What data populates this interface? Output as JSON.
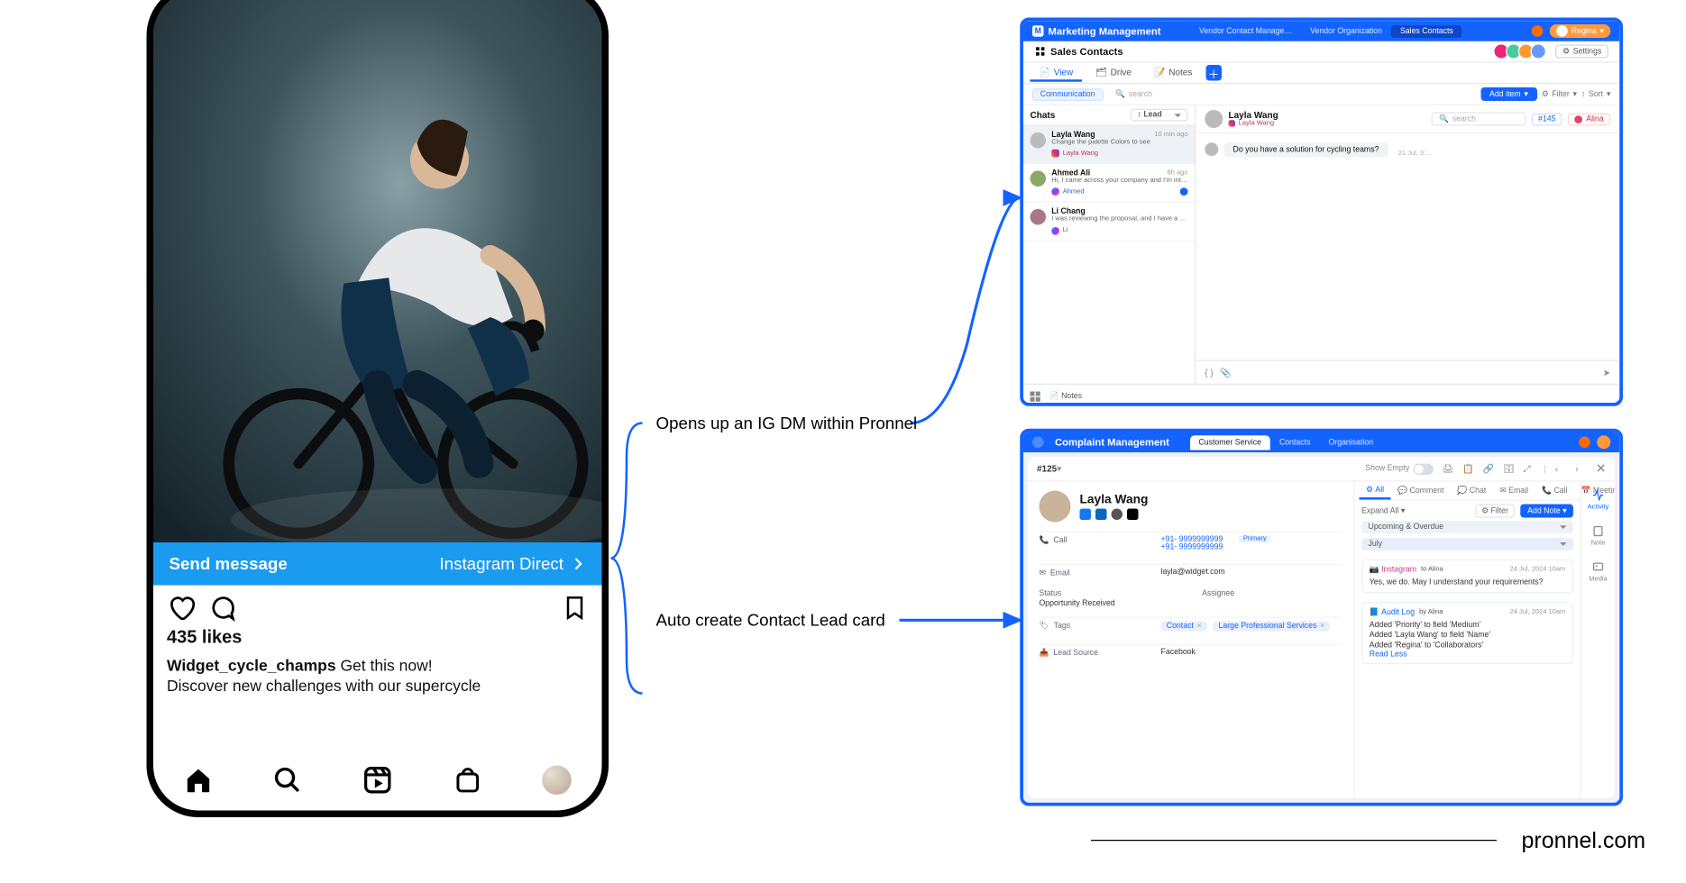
{
  "phone": {
    "send_label": "Send message",
    "direct_label": "Instagram Direct",
    "likes": "435 likes",
    "username": "Widget_cycle_champs",
    "caption_line1": "Get this now!",
    "caption_line2": "Discover new challenges with our supercycle"
  },
  "annotations": {
    "dm_label": "Opens up an IG DM within Pronnel",
    "lead_label": "Auto create Contact Lead card"
  },
  "crm": {
    "app_name": "Marketing Management",
    "header_tabs": [
      "Vendor Contact Manage…",
      "Vendor Organization",
      "Sales Contacts"
    ],
    "header_active": 2,
    "user_name": "Regina",
    "board_title": "Sales Contacts",
    "settings": "Settings",
    "view_tabs": [
      "View",
      "Drive",
      "Notes"
    ],
    "view_active": 0,
    "filter_chip": "Communication",
    "search_placeholder": "search",
    "add_item": "Add item",
    "filter_label": "Filter",
    "sort_label": "Sort",
    "chats_title": "Chats",
    "chats_sort": "Lead",
    "chats": [
      {
        "name": "Layla Wang",
        "preview": "Change the palette Colors to see",
        "time": "10 min ago",
        "source": "Layla Wang",
        "source_type": "ig",
        "active": true
      },
      {
        "name": "Ahmed Ali",
        "preview": "Hi, I came across your company and I'm interested in learning m…",
        "time": "8h ago",
        "source": "Ahmed",
        "source_type": "msn",
        "active": false
      },
      {
        "name": "Li Chang",
        "preview": "I was reviewing the proposal, and I have a few questions about t…",
        "time": "",
        "source": "Li",
        "source_type": "msn",
        "active": false
      }
    ],
    "chat_header": {
      "name": "Layla Wang",
      "sub": "Layla Wang",
      "id": "#145",
      "person": "Alina"
    },
    "chat_message": {
      "text": "Do you have a solution for cycling teams?",
      "time": "21 Jul, 3:…"
    },
    "footer_notes": "Notes"
  },
  "lead": {
    "app_name": "Complaint Management",
    "header_tabs": [
      "Customer Service",
      "Contacts",
      "Organisation"
    ],
    "header_active": 0,
    "id": "#125",
    "show_empty": "Show Empty",
    "contact": {
      "name": "Layla Wang"
    },
    "fields": {
      "call_label": "Call",
      "phone1": "+91- 9999999999",
      "phone2": "+91- 9999999999",
      "primary": "Primary",
      "email_label": "Email",
      "email": "layla@widget.com",
      "status_label": "Status",
      "status_value": "Opportunity Received",
      "assignee_label": "Assignee",
      "tags_label": "Tags",
      "tag1": "Contact",
      "tag2": "Large Professional Services",
      "lead_source_label": "Lead Source",
      "lead_source": "Facebook"
    },
    "right": {
      "tabs": [
        "All",
        "Comment",
        "Chat",
        "Email",
        "Call",
        "Meeting"
      ],
      "expand": "Expand All",
      "filter": "Filter",
      "add": "Add Note",
      "section_upcoming": "Upcoming & Overdue",
      "section_july": "July",
      "item1": {
        "label": "Instagram",
        "who": "to Alina",
        "time": "24 Jul, 2024 10am",
        "text": "Yes, we do. May I understand your requirements?"
      },
      "item2": {
        "label": "Audit Log",
        "who": "by Alina",
        "time": "24 Jul, 2024 10am",
        "text": "Added 'Priority' to field 'Medium'\nAdded 'Layla Wang' to field 'Name'\nAdded 'Regina' to 'Collaborators'",
        "link": "Read Less"
      }
    },
    "sidebar": {
      "activity": "Activity",
      "note": "Note",
      "media": "Media"
    }
  },
  "footer": {
    "domain": "pronnel.com"
  }
}
